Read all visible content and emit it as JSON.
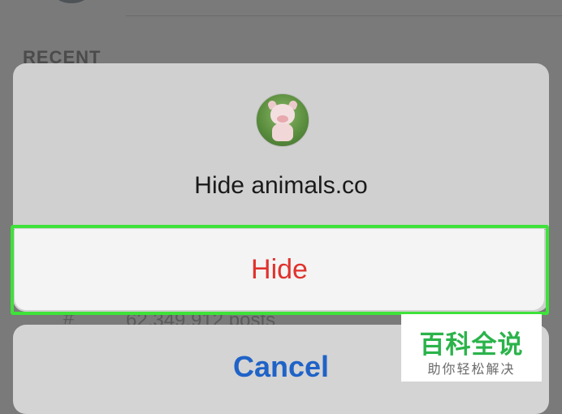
{
  "background": {
    "section_header": "RECENT",
    "row_icon": "hashtag-icon",
    "row_hash": "#",
    "row_text": "62,349,912 posts"
  },
  "action_sheet": {
    "avatar": "account-avatar-pig",
    "title": "Hide animals.co",
    "hide_label": "Hide",
    "cancel_label": "Cancel"
  },
  "watermark": {
    "main": "百科全说",
    "sub": "助你轻松解决"
  },
  "colors": {
    "destructive": "#e0322d",
    "cancel": "#1f63c7",
    "highlight": "#3ee23a",
    "watermark": "#2ab34a"
  }
}
